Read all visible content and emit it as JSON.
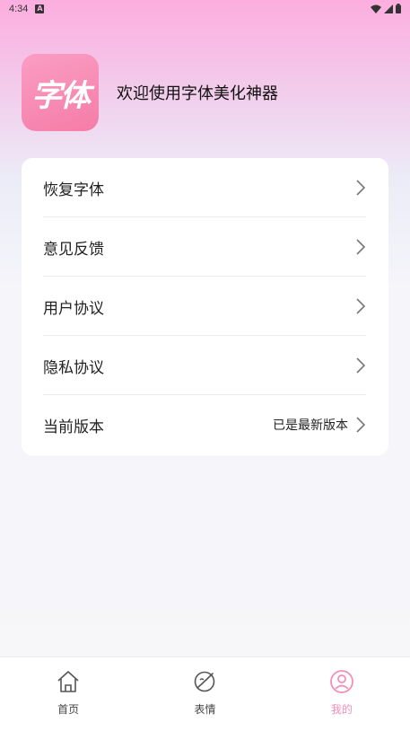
{
  "status_bar": {
    "time": "4:34",
    "notification_glyph": "A"
  },
  "header": {
    "logo_text": "字体",
    "welcome_text": "欢迎使用字体美化神器"
  },
  "menu": {
    "items": [
      {
        "label": "恢复字体",
        "value": ""
      },
      {
        "label": "意见反馈",
        "value": ""
      },
      {
        "label": "用户协议",
        "value": ""
      },
      {
        "label": "隐私协议",
        "value": ""
      },
      {
        "label": "当前版本",
        "value": "已是最新版本"
      }
    ]
  },
  "tabbar": {
    "tabs": [
      {
        "label": "首页",
        "icon": "home-icon",
        "active": false
      },
      {
        "label": "表情",
        "icon": "planet-icon",
        "active": false
      },
      {
        "label": "我的",
        "icon": "user-icon",
        "active": true
      }
    ]
  },
  "colors": {
    "accent": "#f48fb8",
    "logo_bg": "#f57ca6",
    "gradient_top": "#fcaedf"
  }
}
